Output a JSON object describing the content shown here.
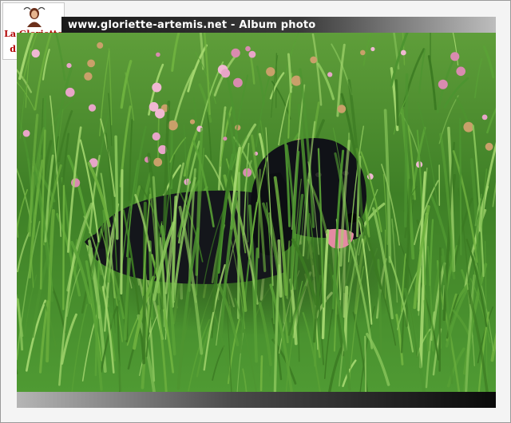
{
  "header": {
    "text": "www.gloriette-artemis.net - Album photo"
  },
  "logo": {
    "line1": "La Gloriette",
    "line2": "d'Artémis"
  },
  "photo": {
    "subject": "black-spaniel-in-clover-meadow"
  },
  "colors": {
    "grass": "#3f8a2a",
    "clover": "#e6a2c4",
    "dog": "#111318",
    "tongue": "#e58aa3",
    "logo_text": "#b00000"
  }
}
